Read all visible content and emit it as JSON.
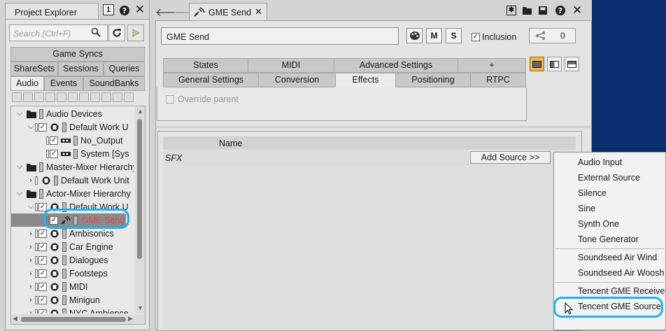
{
  "explorer": {
    "title": "Project Explorer",
    "badge": "1",
    "search_placeholder": "Search (Ctrl+F)",
    "tabs_row1": [
      "Game Syncs"
    ],
    "tabs_row2": [
      "ShareSets",
      "Sessions",
      "Queries"
    ],
    "tabs_row3": [
      "Audio",
      "Events",
      "SoundBanks"
    ],
    "selected_tab": "Audio",
    "tree": [
      {
        "label": "Audio Devices",
        "depth": 0,
        "expanded": true,
        "icon": "folder-icon"
      },
      {
        "label": "Default Work U",
        "depth": 1,
        "expanded": true,
        "icon": "work-unit-icon"
      },
      {
        "label": "No_Output",
        "depth": 2,
        "icon": "device-icon"
      },
      {
        "label": "System [Sys",
        "depth": 2,
        "icon": "device-icon"
      },
      {
        "label": "Master-Mixer Hierarchy",
        "depth": 0,
        "expanded": true,
        "icon": "folder-icon"
      },
      {
        "label": "Default Work Unit",
        "depth": 1,
        "expanded": false,
        "icon": "work-unit-icon"
      },
      {
        "label": "Actor-Mixer Hierarchy",
        "depth": 0,
        "expanded": true,
        "icon": "folder-icon"
      },
      {
        "label": "Default Work U",
        "depth": 1,
        "expanded": true,
        "icon": "work-unit-icon"
      },
      {
        "label": "GME Send",
        "depth": 2,
        "icon": "plugin-icon",
        "highlight": true
      },
      {
        "label": "Ambisonics",
        "depth": 1,
        "expanded": false,
        "icon": "work-unit-icon"
      },
      {
        "label": "Car Engine",
        "depth": 1,
        "expanded": false,
        "icon": "work-unit-icon"
      },
      {
        "label": "Dialogues",
        "depth": 1,
        "expanded": false,
        "icon": "work-unit-icon"
      },
      {
        "label": "Footsteps",
        "depth": 1,
        "expanded": false,
        "icon": "work-unit-icon"
      },
      {
        "label": "MIDI",
        "depth": 1,
        "expanded": false,
        "icon": "work-unit-icon"
      },
      {
        "label": "Minigun",
        "depth": 1,
        "expanded": false,
        "icon": "work-unit-icon"
      },
      {
        "label": "NYC Ambience",
        "depth": 1,
        "expanded": false,
        "icon": "work-unit-icon"
      }
    ]
  },
  "editor": {
    "tab_title": "GME Send",
    "name_value": "GME Send",
    "mute_label": "M",
    "solo_label": "S",
    "inclusion_label": "Inclusion",
    "share_count": "0",
    "tabs_row1": [
      "States",
      "MIDI",
      "Advanced Settings",
      "+"
    ],
    "tabs_row2": [
      "General Settings",
      "Conversion",
      "Effects",
      "Positioning",
      "RTPC"
    ],
    "selected_tab": "Effects",
    "override_parent": "Override parent",
    "list_header_name": "Name",
    "sfx_label": "SFX",
    "add_source_label": "Add Source >>"
  },
  "context_menu": {
    "group1": [
      "Audio Input",
      "External Source",
      "Silence",
      "Sine",
      "Synth One",
      "Tone Generator"
    ],
    "group2": [
      "Soundseed Air Wind",
      "Soundseed Air Woosh"
    ],
    "group3": [
      "Tencent GME Receive",
      "Tencent GME Source"
    ],
    "highlighted": "Tencent GME Source"
  },
  "colors": {
    "highlight_ring": "#1db4ec",
    "error_text": "#e04848",
    "background_blue": "#0a2f6e"
  }
}
